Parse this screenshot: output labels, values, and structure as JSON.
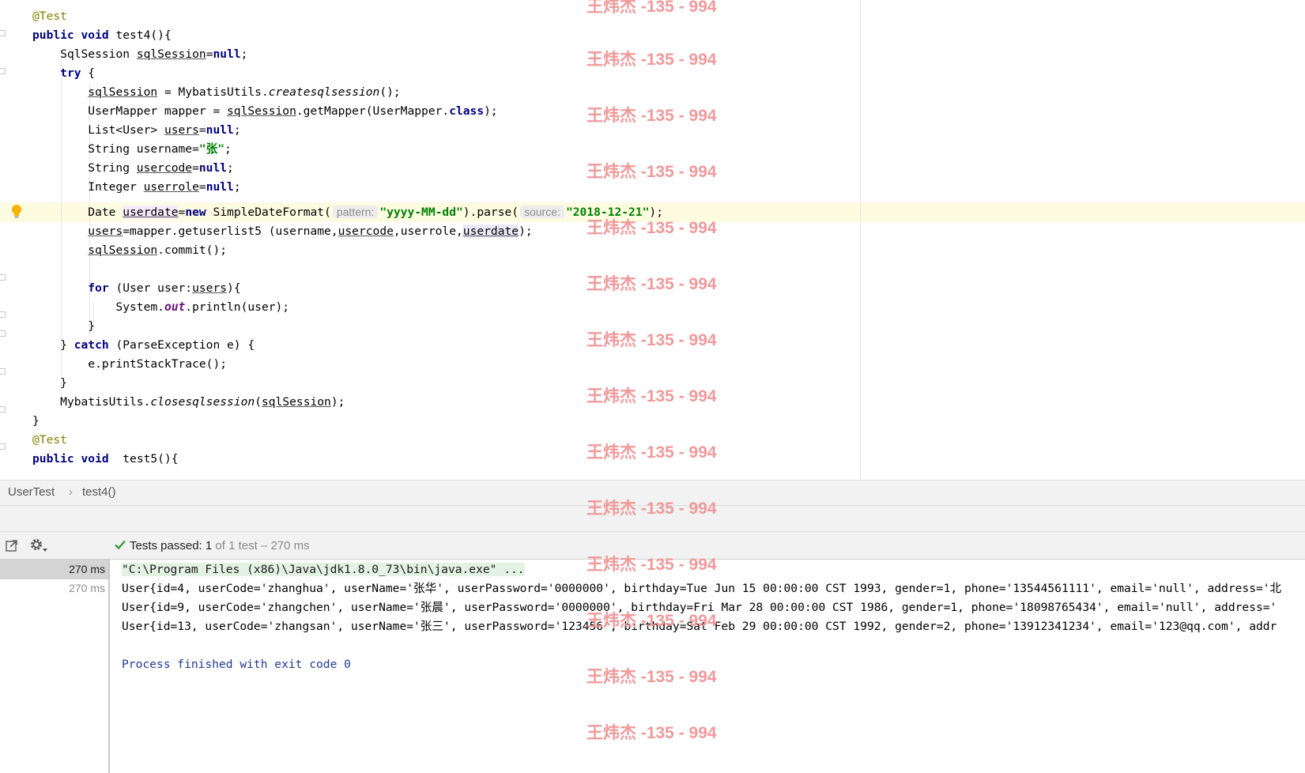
{
  "editor": {
    "code": {
      "annotation": "@Test",
      "test4_signature": "test4(){",
      "kw_public": "public",
      "kw_void": "void",
      "kw_try": "try",
      "kw_new": "new",
      "kw_class": "class",
      "kw_for": "for",
      "kw_catch": "catch",
      "lit_null": "null",
      "var_sqlSession": "sqlSession",
      "var_users": "users",
      "var_usercode": "usercode",
      "var_userrole": "userrole",
      "var_userdate": "userdate",
      "type_SqlSession": "SqlSession",
      "MybatisUtils": "MybatisUtils.",
      "createsqlsession": "createsqlsession",
      "closesqlsession": "closesqlsession",
      "str_zhang": "\"张\"",
      "str_format": "\"yyyy-MM-dd\"",
      "str_date": "\"2018-12-21\"",
      "hint_pattern": "pattern:",
      "hint_source": "source:",
      "out_field": "out",
      "test5_signature": " test5(){"
    }
  },
  "breadcrumb": {
    "class_name": "UserTest",
    "separator": "›",
    "method_name": "test4()"
  },
  "run_panel": {
    "status_label": "Tests passed:",
    "passed_count": "1",
    "status_detail": "of 1 test – 270 ms",
    "tree": {
      "root_time": "270 ms",
      "child_time": "270 ms"
    },
    "console": {
      "command": "\"C:\\Program Files (x86)\\Java\\jdk1.8.0_73\\bin\\java.exe\" ...",
      "output": [
        "User{id=4, userCode='zhanghua', userName='张华', userPassword='0000000', birthday=Tue Jun 15 00:00:00 CST 1993, gender=1, phone='13544561111', email='null', address='北",
        "User{id=9, userCode='zhangchen', userName='张晨', userPassword='0000000', birthday=Fri Mar 28 00:00:00 CST 1986, gender=1, phone='18098765434', email='null', address='",
        "User{id=13, userCode='zhangsan', userName='张三', userPassword='123456', birthday=Sat Feb 29 00:00:00 CST 1992, gender=2, phone='13912341234', email='123@qq.com', addr"
      ],
      "exit_message": "Process finished with exit code 0"
    }
  },
  "watermark": {
    "text": "王炜杰 -135 - 994"
  },
  "colors": {
    "keyword": "#000080",
    "annotation": "#808000",
    "string": "#008000",
    "static_field": "#660e7a",
    "watermark": "#f0999a",
    "pass_check": "#3a9a3a",
    "caret_line": "#fdfce0"
  }
}
